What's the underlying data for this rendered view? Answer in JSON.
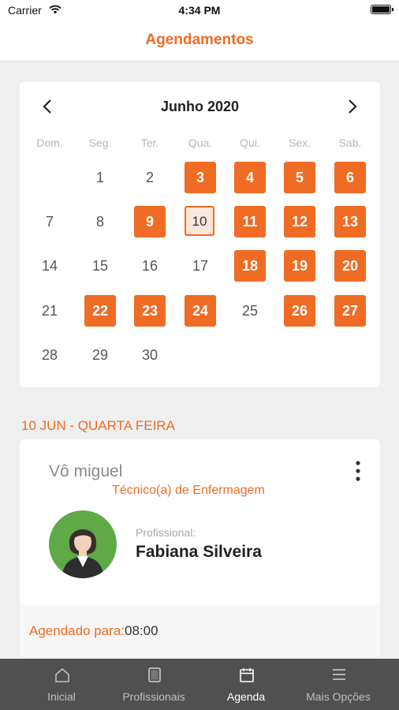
{
  "status_bar": {
    "carrier": "Carrier",
    "time": "4:34 PM"
  },
  "header": {
    "title": "Agendamentos"
  },
  "calendar": {
    "month_label": "Junho 2020",
    "weekdays": [
      "Dom.",
      "Seg.",
      "Ter.",
      "Qua.",
      "Qui.",
      "Sex.",
      "Sab."
    ],
    "days": [
      {
        "label": "1",
        "col": 1,
        "row": 0,
        "state": "normal"
      },
      {
        "label": "2",
        "col": 2,
        "row": 0,
        "state": "normal"
      },
      {
        "label": "3",
        "col": 3,
        "row": 0,
        "state": "available"
      },
      {
        "label": "4",
        "col": 4,
        "row": 0,
        "state": "available"
      },
      {
        "label": "5",
        "col": 5,
        "row": 0,
        "state": "available"
      },
      {
        "label": "6",
        "col": 6,
        "row": 0,
        "state": "available"
      },
      {
        "label": "7",
        "col": 0,
        "row": 1,
        "state": "normal"
      },
      {
        "label": "8",
        "col": 1,
        "row": 1,
        "state": "normal"
      },
      {
        "label": "9",
        "col": 2,
        "row": 1,
        "state": "available"
      },
      {
        "label": "10",
        "col": 3,
        "row": 1,
        "state": "selected"
      },
      {
        "label": "11",
        "col": 4,
        "row": 1,
        "state": "available"
      },
      {
        "label": "12",
        "col": 5,
        "row": 1,
        "state": "available"
      },
      {
        "label": "13",
        "col": 6,
        "row": 1,
        "state": "available"
      },
      {
        "label": "14",
        "col": 0,
        "row": 2,
        "state": "normal"
      },
      {
        "label": "15",
        "col": 1,
        "row": 2,
        "state": "normal"
      },
      {
        "label": "16",
        "col": 2,
        "row": 2,
        "state": "normal"
      },
      {
        "label": "17",
        "col": 3,
        "row": 2,
        "state": "normal"
      },
      {
        "label": "18",
        "col": 4,
        "row": 2,
        "state": "available"
      },
      {
        "label": "19",
        "col": 5,
        "row": 2,
        "state": "available"
      },
      {
        "label": "20",
        "col": 6,
        "row": 2,
        "state": "available"
      },
      {
        "label": "21",
        "col": 0,
        "row": 3,
        "state": "normal"
      },
      {
        "label": "22",
        "col": 1,
        "row": 3,
        "state": "available"
      },
      {
        "label": "23",
        "col": 2,
        "row": 3,
        "state": "available"
      },
      {
        "label": "24",
        "col": 3,
        "row": 3,
        "state": "available"
      },
      {
        "label": "25",
        "col": 4,
        "row": 3,
        "state": "normal"
      },
      {
        "label": "26",
        "col": 5,
        "row": 3,
        "state": "available"
      },
      {
        "label": "27",
        "col": 6,
        "row": 3,
        "state": "available"
      },
      {
        "label": "28",
        "col": 0,
        "row": 4,
        "state": "normal"
      },
      {
        "label": "29",
        "col": 1,
        "row": 4,
        "state": "normal"
      },
      {
        "label": "30",
        "col": 2,
        "row": 4,
        "state": "normal"
      }
    ]
  },
  "section_date": "10 JUN - QUARTA FEIRA",
  "appointment": {
    "patient": "Vô miguel",
    "role": "Técnico(a) de Enfermagem",
    "professional_label": "Profissional:",
    "professional_name": "Fabiana Silveira",
    "scheduled_label": "Agendado para:",
    "scheduled_time": "08:00"
  },
  "tabs": [
    {
      "label": "Inicial",
      "icon": "home-icon",
      "active": false
    },
    {
      "label": "Profissionais",
      "icon": "tablet-icon",
      "active": false
    },
    {
      "label": "Agenda",
      "icon": "calendar-icon",
      "active": true
    },
    {
      "label": "Mais Opções",
      "icon": "menu-icon",
      "active": false
    }
  ],
  "colors": {
    "accent": "#f06b23",
    "available_bg": "#f06b23",
    "selected_bg": "#fbe6dc",
    "tab_bar": "#505050"
  }
}
